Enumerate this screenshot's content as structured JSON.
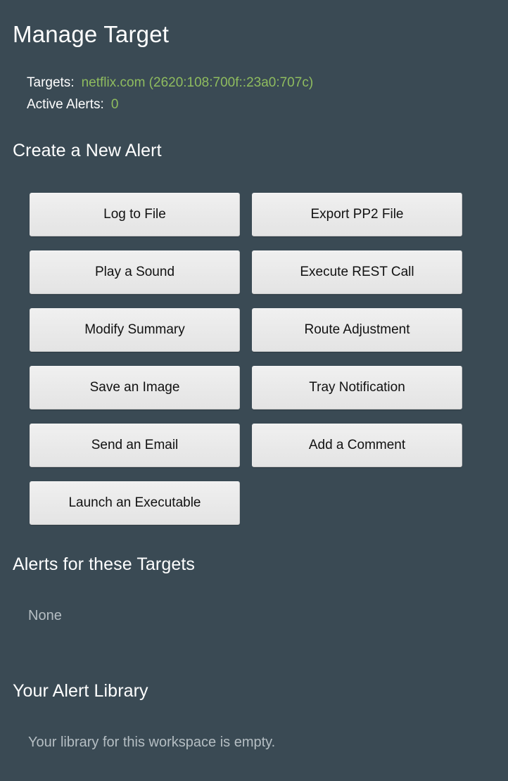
{
  "header": {
    "title": "Manage Target",
    "targets_label": "Targets:",
    "targets_value": "netflix.com (2620:108:700f::23a0:707c)",
    "active_alerts_label": "Active Alerts:",
    "active_alerts_value": "0"
  },
  "create_alert": {
    "heading": "Create a New Alert",
    "buttons": [
      {
        "label": "Log to File"
      },
      {
        "label": "Export PP2 File"
      },
      {
        "label": "Play a Sound"
      },
      {
        "label": "Execute REST Call"
      },
      {
        "label": "Modify Summary"
      },
      {
        "label": "Route Adjustment"
      },
      {
        "label": "Save an Image"
      },
      {
        "label": "Tray Notification"
      },
      {
        "label": "Send an Email"
      },
      {
        "label": "Add a Comment"
      },
      {
        "label": "Launch an Executable"
      }
    ]
  },
  "alerts_section": {
    "heading": "Alerts for these Targets",
    "empty_text": "None"
  },
  "library_section": {
    "heading": "Your Alert Library",
    "empty_text": "Your library for this workspace is empty."
  },
  "colors": {
    "background": "#3a4a54",
    "accent_green": "#8fbc5f",
    "button_face": "#ececec",
    "muted_text": "#b5bec3"
  }
}
